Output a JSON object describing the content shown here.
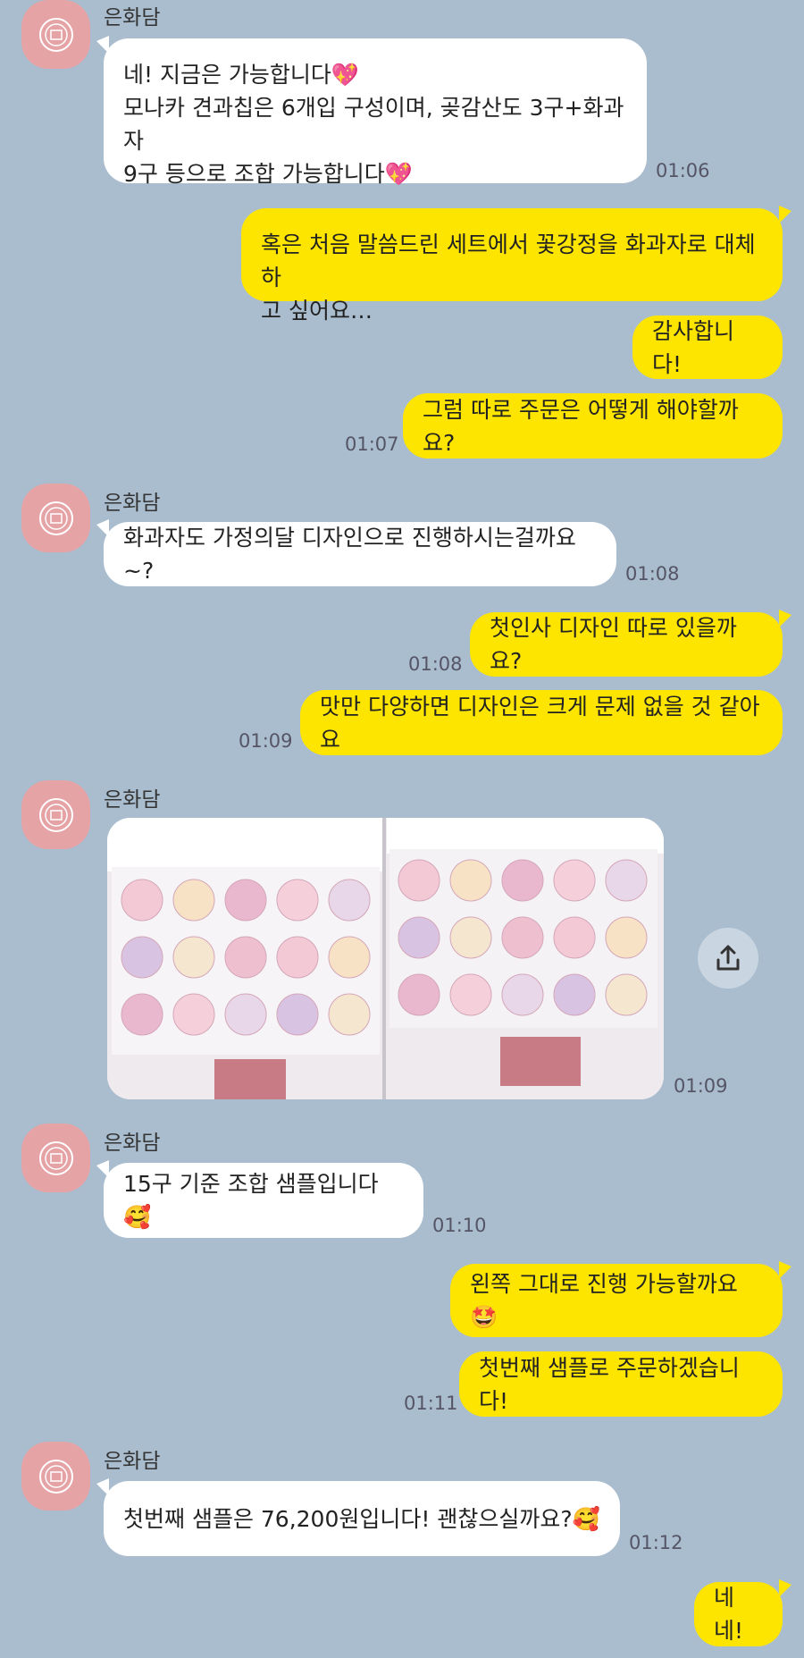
{
  "sender_name": "은화담",
  "messages": {
    "m1": {
      "line1": "네! 지금은 가능합니다💖",
      "line2": "모나카 견과칩은 6개입 구성이며, 곶감산도 3구+화과자",
      "line3": "9구 등으로 조합 가능합니다💖",
      "time": "01:06"
    },
    "m2": {
      "line1": "혹은 처음 말씀드린 세트에서 꽃강정을 화과자로 대체하",
      "line2": "고 싶어요…"
    },
    "m3": {
      "text": "감사합니다!"
    },
    "m4": {
      "text": "그럼 따로 주문은 어떻게 해야할까요?",
      "time": "01:07"
    },
    "m5": {
      "text": "화과자도 가정의달 디자인으로 진행하시는걸까요~?",
      "time": "01:08"
    },
    "m6": {
      "text": "첫인사 디자인 따로 있을까요?",
      "time": "01:08"
    },
    "m7": {
      "text": "맛만 다양하면 디자인은 크게 문제 없을 것 같아요",
      "time": "01:09"
    },
    "m8": {
      "time": "01:09"
    },
    "m9": {
      "text": "15구 기준 조합 샘플입니다🥰",
      "time": "01:10"
    },
    "m10": {
      "text": "왼쪽 그대로 진행 가능할까요🤩"
    },
    "m11": {
      "text": "첫번째 샘플로 주문하겠습니다!",
      "time": "01:11"
    },
    "m12": {
      "text": "첫번째 샘플은 76,200원입니다! 괜찮으실까요?🥰",
      "time": "01:12"
    },
    "m13": {
      "text": "네네!"
    }
  },
  "colors": {
    "background": "#a9bdce",
    "incoming": "#ffffff",
    "outgoing": "#fee500",
    "avatar": "#e6a3a6"
  },
  "icons": {
    "avatar": "store-logo-icon",
    "share": "share-icon"
  }
}
